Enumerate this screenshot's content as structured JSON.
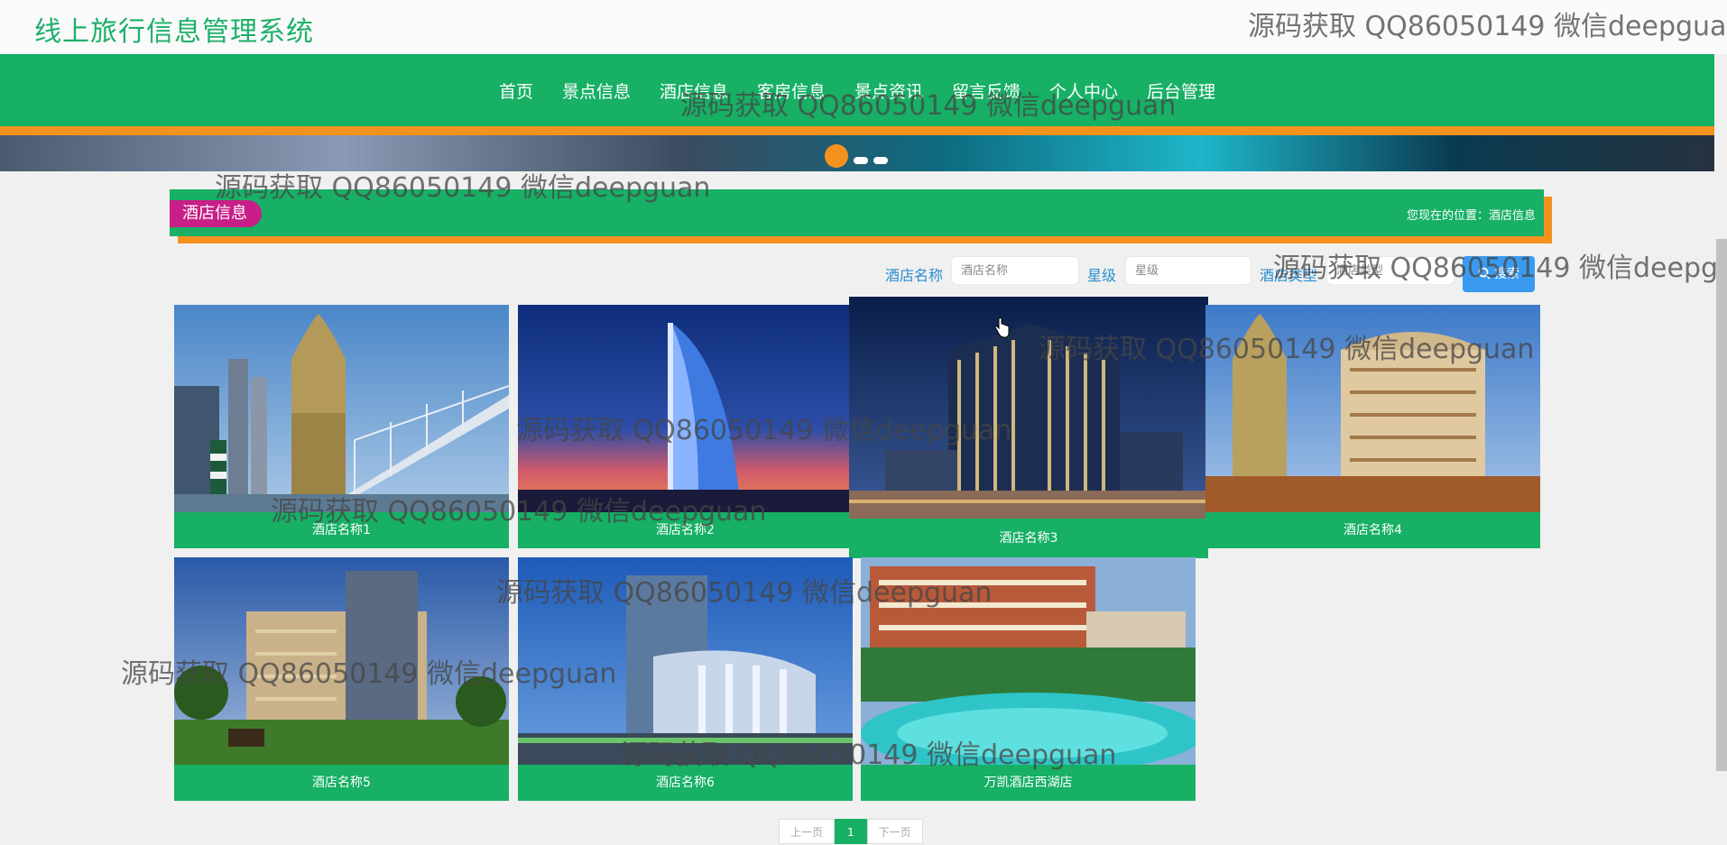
{
  "site": {
    "title": "线上旅行信息管理系统"
  },
  "nav": {
    "items": [
      "首页",
      "景点信息",
      "酒店信息",
      "客房信息",
      "景点资讯",
      "留言反馈",
      "个人中心",
      "后台管理"
    ]
  },
  "section": {
    "title": "酒店信息",
    "breadcrumb": "您现在的位置：酒店信息"
  },
  "search": {
    "name_label": "酒店名称",
    "name_placeholder": "酒店名称",
    "star_label": "星级",
    "star_placeholder": "星级",
    "type_label": "酒店类型",
    "type_placeholder": "酒店类型",
    "button": "搜索"
  },
  "hotels": [
    {
      "name": "酒店名称1",
      "image": "casino-tower-bridge"
    },
    {
      "name": "酒店名称2",
      "image": "sail-tower-dusk"
    },
    {
      "name": "酒店名称3",
      "image": "glass-hotel-night"
    },
    {
      "name": "酒店名称4",
      "image": "casino-resort"
    },
    {
      "name": "酒店名称5",
      "image": "palm-lawn-hotel"
    },
    {
      "name": "酒店名称6",
      "image": "modern-hotel-facade"
    },
    {
      "name": "万凯酒店西湖店",
      "image": "pool-resort"
    }
  ],
  "pagination": {
    "prev": "上一页",
    "current": "1",
    "next": "下一页"
  },
  "watermark": "源码获取 QQ86050149 微信deepguan",
  "colors": {
    "primary": "#17b065",
    "accent": "#f5921e",
    "badge": "#c71e87",
    "button": "#3a9af0"
  }
}
